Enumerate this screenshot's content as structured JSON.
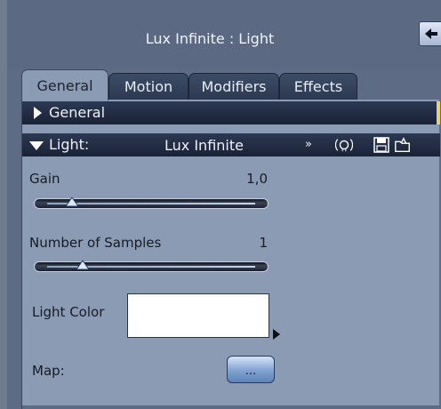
{
  "window": {
    "title": "Lux Infinite : Light",
    "back_icon": "arrow-left-icon"
  },
  "tabs": [
    {
      "label": "General",
      "active": true
    },
    {
      "label": "Motion",
      "active": false
    },
    {
      "label": "Modifiers",
      "active": false
    },
    {
      "label": "Effects",
      "active": false
    }
  ],
  "sections": {
    "general": {
      "label": "General",
      "expanded": false
    },
    "light": {
      "label": "Light:",
      "type": "Lux Infinite",
      "expanded": true,
      "chevron": "»"
    }
  },
  "params": {
    "gain": {
      "label": "Gain",
      "value": "1,0",
      "level": 0.12
    },
    "samples": {
      "label": "Number of Samples",
      "value": "1",
      "level": 0.17
    },
    "light_color": {
      "label": "Light Color",
      "color": "#ffffff"
    },
    "map": {
      "label": "Map:",
      "button_label": "..."
    }
  },
  "colors": {
    "bar": "#1f2840",
    "panel": "#8c9bb4",
    "accent": "#e7cf78"
  }
}
